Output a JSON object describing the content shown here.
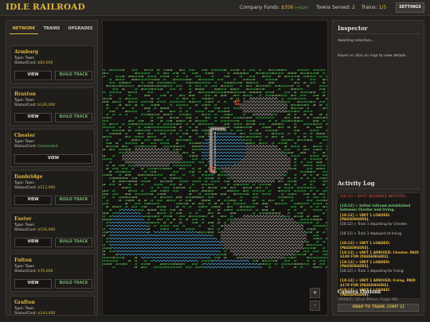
{
  "header": {
    "title": "IDLE RAILROAD",
    "funds_label": "Company Funds:",
    "funds_value": "$356",
    "funds_rate": "(+$1/s)",
    "towns_label": "Towns Served:",
    "towns_value": "2",
    "trains_label": "Trains:",
    "trains_value": "1/5",
    "settings_label": "SETTINGS"
  },
  "tabs": [
    {
      "label": "NETWORK",
      "active": true
    },
    {
      "label": "TRAINS",
      "active": false
    },
    {
      "label": "UPGRADES",
      "active": false
    }
  ],
  "towns": [
    {
      "name": "Armburg",
      "type": "Type: Town",
      "status_label": "Status/Cost:",
      "status": "$84,000",
      "connected": false,
      "view": "VIEW",
      "build": "BUILD TRACK"
    },
    {
      "name": "Braxton",
      "type": "Type: Town",
      "status_label": "Status/Cost:",
      "status": "$126,000",
      "connected": false,
      "view": "VIEW",
      "build": "BUILD TRACK"
    },
    {
      "name": "Chester",
      "type": "Type: Town",
      "status_label": "Status/Cost:",
      "status": "Connected",
      "connected": true,
      "view": "VIEW",
      "build": ""
    },
    {
      "name": "Danbridge",
      "type": "Type: Town",
      "status_label": "Status/Cost:",
      "status": "$112,000",
      "connected": false,
      "view": "VIEW",
      "build": "BUILD TRACK"
    },
    {
      "name": "Exeter",
      "type": "Type: Town",
      "status_label": "Status/Cost:",
      "status": "$156,000",
      "connected": false,
      "view": "VIEW",
      "build": "BUILD TRACK"
    },
    {
      "name": "Fulton",
      "type": "Type: Town",
      "status_label": "Status/Cost:",
      "status": "$76,000",
      "connected": false,
      "view": "VIEW",
      "build": "BUILD TRACK"
    },
    {
      "name": "Grafton",
      "type": "Type: Town",
      "status_label": "Status/Cost:",
      "status": "$144,000",
      "connected": false,
      "view": "VIEW",
      "build": "BUILD TRACK"
    }
  ],
  "map": {
    "zoom_in": "+",
    "zoom_out": "-",
    "colors": {
      "grass": "#2ecc40",
      "grass_light": "#9be37a",
      "water": "#4aa3df",
      "mountain": "#9a9590",
      "track": "#cfcac2",
      "town": "#e74c3c"
    }
  },
  "inspector": {
    "title": "Inspector",
    "status": "Awaiting selection...",
    "hint": "Hover or click on map to view details."
  },
  "activity": {
    "title": "Activity Log",
    "lines": [
      {
        "text": "[18:12] > BOOT SEQUENCE INITIATED....",
        "style": "red"
      },
      {
        "text": "[18:12] > Initial railroad established between Chester and Irving.",
        "style": "green"
      },
      {
        "text": "[18:12] > UNIT 1 LOADED: [PASSENGERS].",
        "style": "gold"
      },
      {
        "text": "[18:12] > Train 1 departing for Chester.",
        "style": "plain"
      },
      {
        "text": "[18:12] > Train 1 deployed at Irving.",
        "style": "plain"
      },
      {
        "text": "[18:12] > UNIT 1 LOADED: [PASSENGERS].",
        "style": "gold"
      },
      {
        "text": "[18:12] > UNIT 1 ARRIVED: Chester. PAID $180 FOR [PASSENGERS].",
        "style": "gold"
      },
      {
        "text": "[18:12] > UNIT 1 LOADED: [PASSENGERS].",
        "style": "gold"
      },
      {
        "text": "[18:12] > Train 1 departing for Irving.",
        "style": "plain"
      },
      {
        "text": "[18:13] > UNIT 1 ARRIVED: Irving. PAID $170 FOR [PASSENGERS].",
        "style": "gold"
      },
      {
        "text": "[18:13] > UNIT 1 LOADED: [PASSENGERS].",
        "style": "gold"
      },
      {
        "text": "[18:13] > Train 1 departing for Chester.",
        "style": "plain"
      }
    ]
  },
  "camera": {
    "title": "Camera Options",
    "hint": "[WASD] / Scroll Wheel / Edge Pan",
    "snap_label": "SNAP TO TRAIN: [UNIT 1]"
  }
}
